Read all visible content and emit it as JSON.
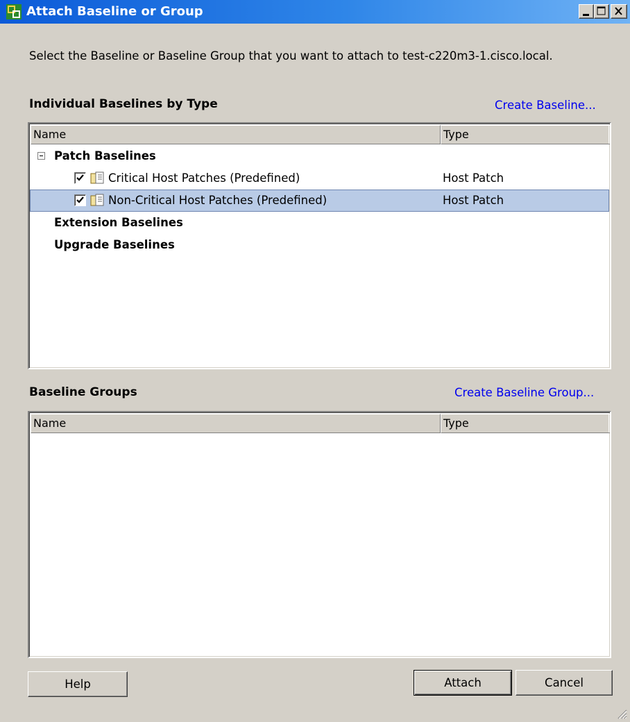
{
  "window": {
    "title": "Attach Baseline or Group",
    "prompt": "Select the Baseline or Baseline Group that you want to attach to test-c220m3-1.cisco.local."
  },
  "individual": {
    "title": "Individual Baselines by Type",
    "create_link": "Create Baseline...",
    "columns": {
      "name": "Name",
      "type": "Type"
    },
    "groups": [
      {
        "label": "Patch Baselines",
        "expanded": true,
        "items": [
          {
            "label": "Critical Host Patches (Predefined)",
            "type": "Host Patch",
            "checked": true,
            "selected": false
          },
          {
            "label": "Non-Critical Host Patches (Predefined)",
            "type": "Host Patch",
            "checked": true,
            "selected": true
          }
        ]
      },
      {
        "label": "Extension Baselines"
      },
      {
        "label": "Upgrade Baselines"
      }
    ]
  },
  "groups_section": {
    "title": "Baseline Groups",
    "create_link": "Create Baseline Group...",
    "columns": {
      "name": "Name",
      "type": "Type"
    }
  },
  "buttons": {
    "help": "Help",
    "attach": "Attach",
    "cancel": "Cancel"
  },
  "colors": {
    "selection": "#b9cbe6",
    "link": "#0000ee",
    "titlebar": "#2f86e8"
  },
  "icons": [
    "vsphere-app-icon",
    "minimize-icon",
    "maximize-icon",
    "close-icon",
    "collapse-icon",
    "checkbox-checked-icon",
    "baseline-icon",
    "resize-grip-icon"
  ]
}
